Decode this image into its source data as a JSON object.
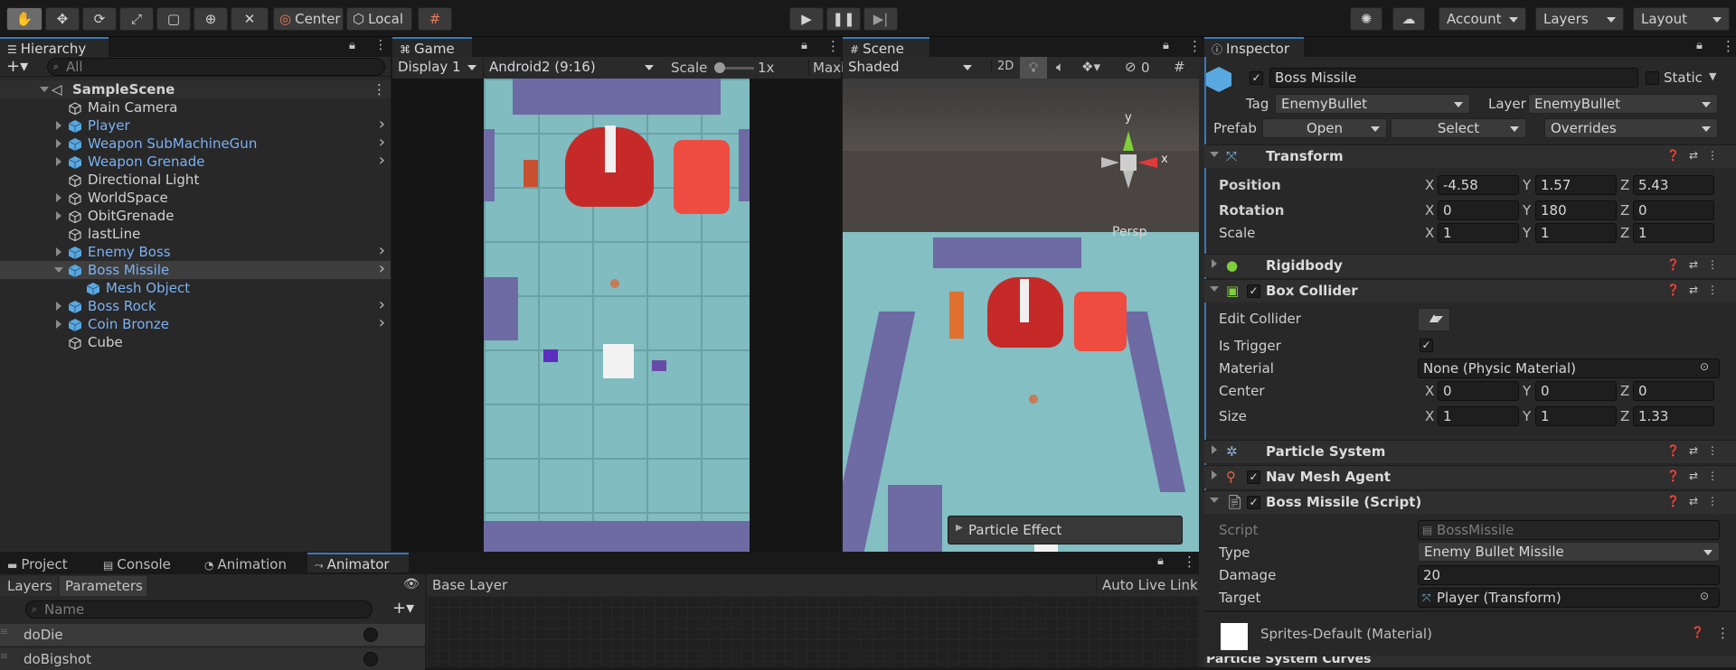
{
  "toolbar": {
    "pivot": "Center",
    "space": "Local",
    "account": "Account",
    "layers": "Layers",
    "layout": "Layout"
  },
  "hierarchy": {
    "tab": "Hierarchy",
    "search_placeholder": "All",
    "scene": "SampleScene",
    "items": [
      {
        "label": "Main Camera",
        "prefab": false,
        "expand": false
      },
      {
        "label": "Player",
        "prefab": true,
        "expand": true
      },
      {
        "label": "Weapon SubMachineGun",
        "prefab": true,
        "expand": true
      },
      {
        "label": "Weapon Grenade",
        "prefab": true,
        "expand": true
      },
      {
        "label": "Directional Light",
        "prefab": false,
        "expand": false
      },
      {
        "label": "WorldSpace",
        "prefab": false,
        "expand": true
      },
      {
        "label": "ObitGrenade",
        "prefab": false,
        "expand": true
      },
      {
        "label": "lastLine",
        "prefab": false,
        "expand": false
      },
      {
        "label": "Enemy Boss",
        "prefab": true,
        "expand": true
      },
      {
        "label": "Boss Missile",
        "prefab": true,
        "expand": true
      },
      {
        "label": "Mesh Object",
        "prefab": true,
        "expand": false
      },
      {
        "label": "Boss Rock",
        "prefab": true,
        "expand": true
      },
      {
        "label": "Coin Bronze",
        "prefab": true,
        "expand": true
      },
      {
        "label": "Cube",
        "prefab": false,
        "expand": false
      }
    ]
  },
  "game": {
    "tab": "Game",
    "display": "Display 1",
    "resolution": "Android2 (9:16)",
    "scale_label": "Scale",
    "scale_value": "1x",
    "maximize": "Maxi"
  },
  "scene_view": {
    "tab": "Scene",
    "shading": "Shaded",
    "mode_2d": "2D",
    "hidden_count": "0",
    "persp": "Persp",
    "axis_x": "x",
    "axis_y": "y",
    "particle_popup": "Particle Effect"
  },
  "inspector": {
    "tab": "Inspector",
    "object_name": "Boss Missile",
    "static_label": "Static",
    "tag_label": "Tag",
    "tag_value": "EnemyBullet",
    "layer_label": "Layer",
    "layer_value": "EnemyBullet",
    "prefab_label": "Prefab",
    "open": "Open",
    "select": "Select",
    "overrides": "Overrides",
    "transform": {
      "title": "Transform",
      "position_label": "Position",
      "rotation_label": "Rotation",
      "scale_label": "Scale",
      "position": [
        "-4.58",
        "1.57",
        "5.43"
      ],
      "rotation": [
        "0",
        "180",
        "0"
      ],
      "scale": [
        "1",
        "1",
        "1"
      ]
    },
    "rigidbody": "Rigidbody",
    "box_collider": {
      "title": "Box Collider",
      "edit_collider": "Edit Collider",
      "is_trigger": "Is Trigger",
      "material_label": "Material",
      "material_value": "None (Physic Material)",
      "center_label": "Center",
      "center": [
        "0",
        "0",
        "0"
      ],
      "size_label": "Size",
      "size": [
        "1",
        "1",
        "1.33"
      ]
    },
    "particle_system": "Particle System",
    "nav_mesh_agent": "Nav Mesh Agent",
    "script": {
      "title": "Boss Missile (Script)",
      "script_label": "Script",
      "script_value": "BossMissile",
      "type_label": "Type",
      "type_value": "Enemy Bullet Missile",
      "damage_label": "Damage",
      "damage_value": "20",
      "target_label": "Target",
      "target_value": "Player (Transform)"
    },
    "material": "Sprites-Default (Material)",
    "curves": "Particle System Curves"
  },
  "bottom": {
    "tabs": [
      "Project",
      "Console",
      "Animation",
      "Animator"
    ],
    "sub_tabs": [
      "Layers",
      "Parameters"
    ],
    "name_placeholder": "Name",
    "base_layer": "Base Layer",
    "auto_live_link": "Auto Live Link",
    "params": [
      "doDie",
      "doBigshot"
    ]
  },
  "axis_labels": {
    "x": "X",
    "y": "Y",
    "z": "Z"
  },
  "colors": {
    "accent": "#3a79bb",
    "prefab_text": "#7cb1f2",
    "enemy_red": "#e0322e",
    "floor": "#80bcc0",
    "wall": "#6e6aa3"
  }
}
